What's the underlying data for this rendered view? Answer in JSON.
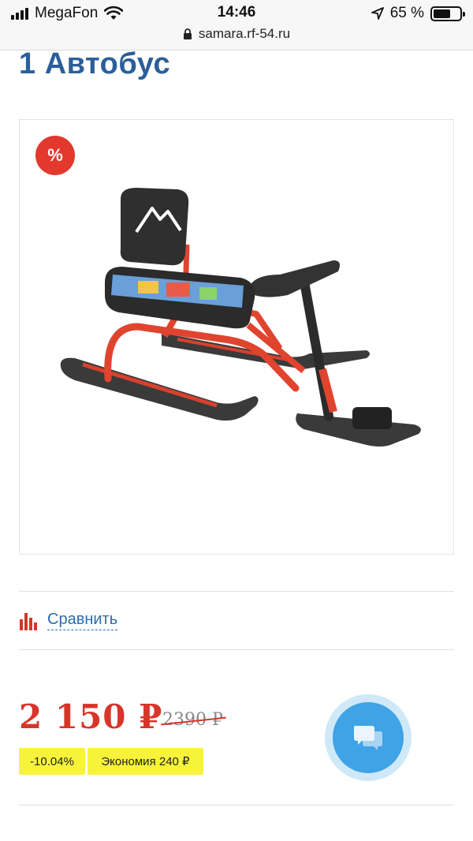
{
  "status_bar": {
    "carrier": "MegaFon",
    "time": "14:46",
    "battery_percent": "65 %",
    "battery_level": 0.65,
    "url": "samara.rf-54.ru"
  },
  "page": {
    "title": "1 Автобус",
    "discount_badge": "%",
    "compare_label": "Сравнить"
  },
  "price": {
    "current": "2 150 ₽",
    "old": "2390 ₽",
    "discount_tag": "-10.04%",
    "savings_tag": "Экономия 240 ₽"
  },
  "colors": {
    "accent_blue": "#2b5f9a",
    "price_red": "#d8352a",
    "tag_yellow": "#f6f33a",
    "chat_blue": "#3fa3e6"
  },
  "icons": {
    "signal": "signal-bars-icon",
    "wifi": "wifi-icon",
    "location": "location-arrow-icon",
    "battery": "battery-icon",
    "lock": "lock-icon",
    "compare": "bar-chart-icon",
    "chat": "chat-bubbles-icon"
  }
}
